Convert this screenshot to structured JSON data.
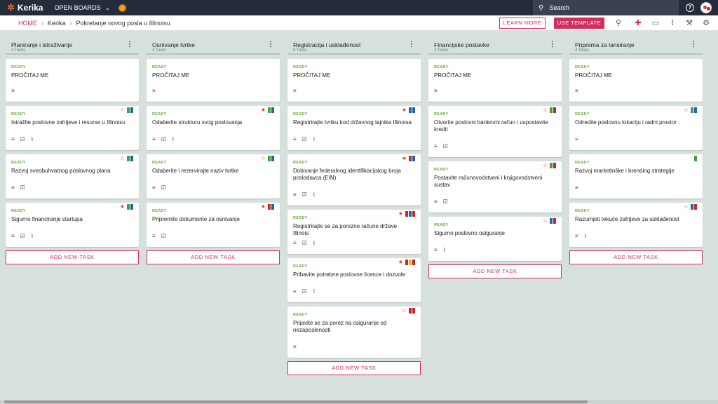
{
  "topbar": {
    "logo": "Kerika",
    "open_boards": "OPEN BOARDS",
    "search_placeholder": "Search"
  },
  "header": {
    "breadcrumb": [
      "HOME",
      "Kerika",
      "Pokretanje novog posla u Illinoisu"
    ],
    "learn_more": "LEARN MORE",
    "use_template": "USE TEMPLATE"
  },
  "add_task_label": "ADD NEW TASK",
  "columns": [
    {
      "title": "Planiranje i istraživanje",
      "count": "4 Tasks",
      "cards": [
        {
          "status": "READY",
          "title": "PROČITAJ ME"
        },
        {
          "status": "READY",
          "title": "Istražite poslovne zahtjeve i resurse u Illinoisu"
        },
        {
          "status": "READY",
          "title": "Razvoj sveobuhvatnog poslovnog plana"
        },
        {
          "status": "READY",
          "title": "Sigurno financiranje startupa"
        }
      ]
    },
    {
      "title": "Osnivanje tvrtke",
      "count": "4 Tasks",
      "cards": [
        {
          "status": "READY",
          "title": "PROČITAJ ME"
        },
        {
          "status": "READY",
          "title": "Odaberite strukturu svog poslovanja"
        },
        {
          "status": "READY",
          "title": "Odaberite i rezervirajte naziv tvrtke"
        },
        {
          "status": "READY",
          "title": "Pripremite dokumente za osnivanje"
        }
      ]
    },
    {
      "title": "Registracija i usklađenost",
      "count": "6 Tasks",
      "cards": [
        {
          "status": "READY",
          "title": "PROČITAJ ME"
        },
        {
          "status": "READY",
          "title": "Registrirajte tvrtku kod državnog tajnika Illinoisa"
        },
        {
          "status": "READY",
          "title": "Dobivanje federalnog identifikacijskog broja poslodavca (EIN)"
        },
        {
          "status": "READY",
          "title": "Registrirajte se za porezne račune države Illinois"
        },
        {
          "status": "READY",
          "title": "Pribavite potrebne poslovne licence i dozvole"
        },
        {
          "status": "READY",
          "title": "Prijavite se za porez na osiguranje od nezaposlenosti"
        }
      ]
    },
    {
      "title": "Financijske postavke",
      "count": "4 Tasks",
      "cards": [
        {
          "status": "READY",
          "title": "PROČITAJ ME"
        },
        {
          "status": "READY",
          "title": "Otvorite poslovni bankovni račun i uspostavite kredit"
        },
        {
          "status": "READY",
          "title": "Postavite računovodstveni i knjigovodstveni sustav"
        },
        {
          "status": "READY",
          "title": "Sigurno poslovno osiguranje"
        }
      ]
    },
    {
      "title": "Priprema za lansiranje",
      "count": "4 Tasks",
      "cards": [
        {
          "status": "READY",
          "title": "PROČITAJ ME"
        },
        {
          "status": "READY",
          "title": "Odredite poslovnu lokaciju i radni prostor"
        },
        {
          "status": "READY",
          "title": "Razvoj marketinške i brending strategije"
        },
        {
          "status": "READY",
          "title": "Razumjeti tekuće zahtjeve za usklađenost"
        }
      ]
    }
  ],
  "colors": {
    "accent": "#d32f5e",
    "ready": "#67ab3a",
    "flag_green": "#43a047",
    "flag_blue": "#1e63b5",
    "flag_red": "#c62828",
    "flag_yellow": "#f5b800",
    "star_red": "#e53935"
  }
}
